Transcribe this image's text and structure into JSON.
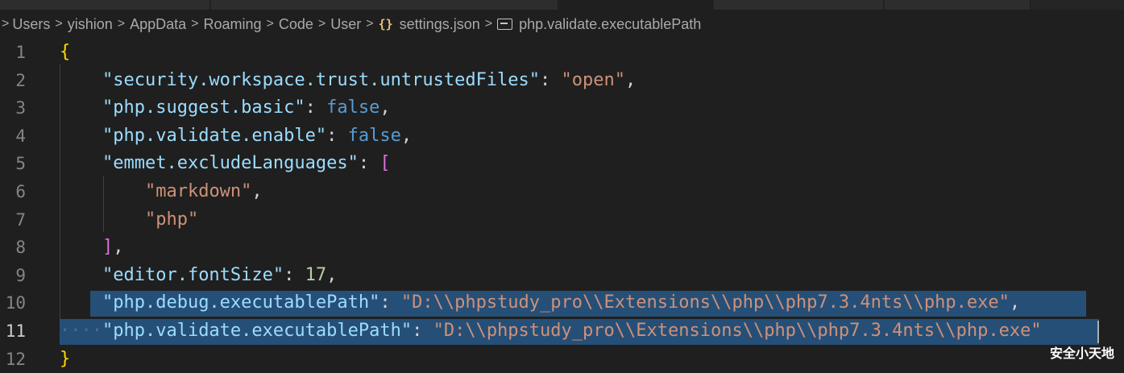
{
  "breadcrumb": {
    "items": [
      "Users",
      "yishion",
      "AppData",
      "Roaming",
      "Code",
      "User",
      "settings.json",
      "php.validate.executablePath"
    ],
    "file_icon": "{}",
    "file_icon_name": "json-braces-icon",
    "property_icon_name": "property-icon"
  },
  "editor": {
    "language": "json",
    "active_line": 11,
    "selected_lines": [
      10,
      11
    ],
    "lines": [
      {
        "num": "1",
        "tokens": [
          {
            "t": "{",
            "c": "br1"
          }
        ]
      },
      {
        "num": "2",
        "tokens": [
          {
            "t": "    ",
            "c": "p"
          },
          {
            "t": "\"security.workspace.trust.untrustedFiles\"",
            "c": "k"
          },
          {
            "t": ": ",
            "c": "p"
          },
          {
            "t": "\"open\"",
            "c": "s"
          },
          {
            "t": ",",
            "c": "p"
          }
        ]
      },
      {
        "num": "3",
        "tokens": [
          {
            "t": "    ",
            "c": "p"
          },
          {
            "t": "\"php.suggest.basic\"",
            "c": "k"
          },
          {
            "t": ": ",
            "c": "p"
          },
          {
            "t": "false",
            "c": "b"
          },
          {
            "t": ",",
            "c": "p"
          }
        ]
      },
      {
        "num": "4",
        "tokens": [
          {
            "t": "    ",
            "c": "p"
          },
          {
            "t": "\"php.validate.enable\"",
            "c": "k"
          },
          {
            "t": ": ",
            "c": "p"
          },
          {
            "t": "false",
            "c": "b"
          },
          {
            "t": ",",
            "c": "p"
          }
        ]
      },
      {
        "num": "5",
        "tokens": [
          {
            "t": "    ",
            "c": "p"
          },
          {
            "t": "\"emmet.excludeLanguages\"",
            "c": "k"
          },
          {
            "t": ": ",
            "c": "p"
          },
          {
            "t": "[",
            "c": "br2"
          }
        ]
      },
      {
        "num": "6",
        "tokens": [
          {
            "t": "        ",
            "c": "p"
          },
          {
            "t": "\"markdown\"",
            "c": "s"
          },
          {
            "t": ",",
            "c": "p"
          }
        ]
      },
      {
        "num": "7",
        "tokens": [
          {
            "t": "        ",
            "c": "p"
          },
          {
            "t": "\"php\"",
            "c": "s"
          }
        ]
      },
      {
        "num": "8",
        "tokens": [
          {
            "t": "    ",
            "c": "p"
          },
          {
            "t": "]",
            "c": "br2"
          },
          {
            "t": ",",
            "c": "p"
          }
        ]
      },
      {
        "num": "9",
        "tokens": [
          {
            "t": "    ",
            "c": "p"
          },
          {
            "t": "\"editor.fontSize\"",
            "c": "k"
          },
          {
            "t": ": ",
            "c": "p"
          },
          {
            "t": "17",
            "c": "n"
          },
          {
            "t": ",",
            "c": "p"
          }
        ]
      },
      {
        "num": "10",
        "tokens": [
          {
            "t": "    ",
            "c": "p"
          },
          {
            "t": "\"php.debug.executablePath\"",
            "c": "k"
          },
          {
            "t": ": ",
            "c": "p"
          },
          {
            "t": "\"D:\\\\phpstudy_pro\\\\Extensions\\\\php\\\\php7.3.4nts\\\\php.exe\"",
            "c": "s"
          },
          {
            "t": ",",
            "c": "p"
          }
        ]
      },
      {
        "num": "11",
        "tokens": [
          {
            "t": "····",
            "c": "ws"
          },
          {
            "t": "\"php.validate.executablePath\"",
            "c": "k"
          },
          {
            "t": ": ",
            "c": "p"
          },
          {
            "t": "\"D:\\\\phpstudy_pro\\\\Extensions\\\\php\\\\php7.3.4nts\\\\php.exe\"",
            "c": "s"
          }
        ]
      },
      {
        "num": "12",
        "tokens": [
          {
            "t": "}",
            "c": "br1"
          }
        ]
      }
    ]
  },
  "watermark": "安全小天地",
  "colors": {
    "background": "#1f1f1f",
    "selection": "#264f78",
    "key": "#9cdcfe",
    "string": "#ce9178",
    "boolean": "#569cd6",
    "number": "#b5cea8",
    "bracket_level1": "#ffd700",
    "bracket_level2": "#da70d6"
  }
}
